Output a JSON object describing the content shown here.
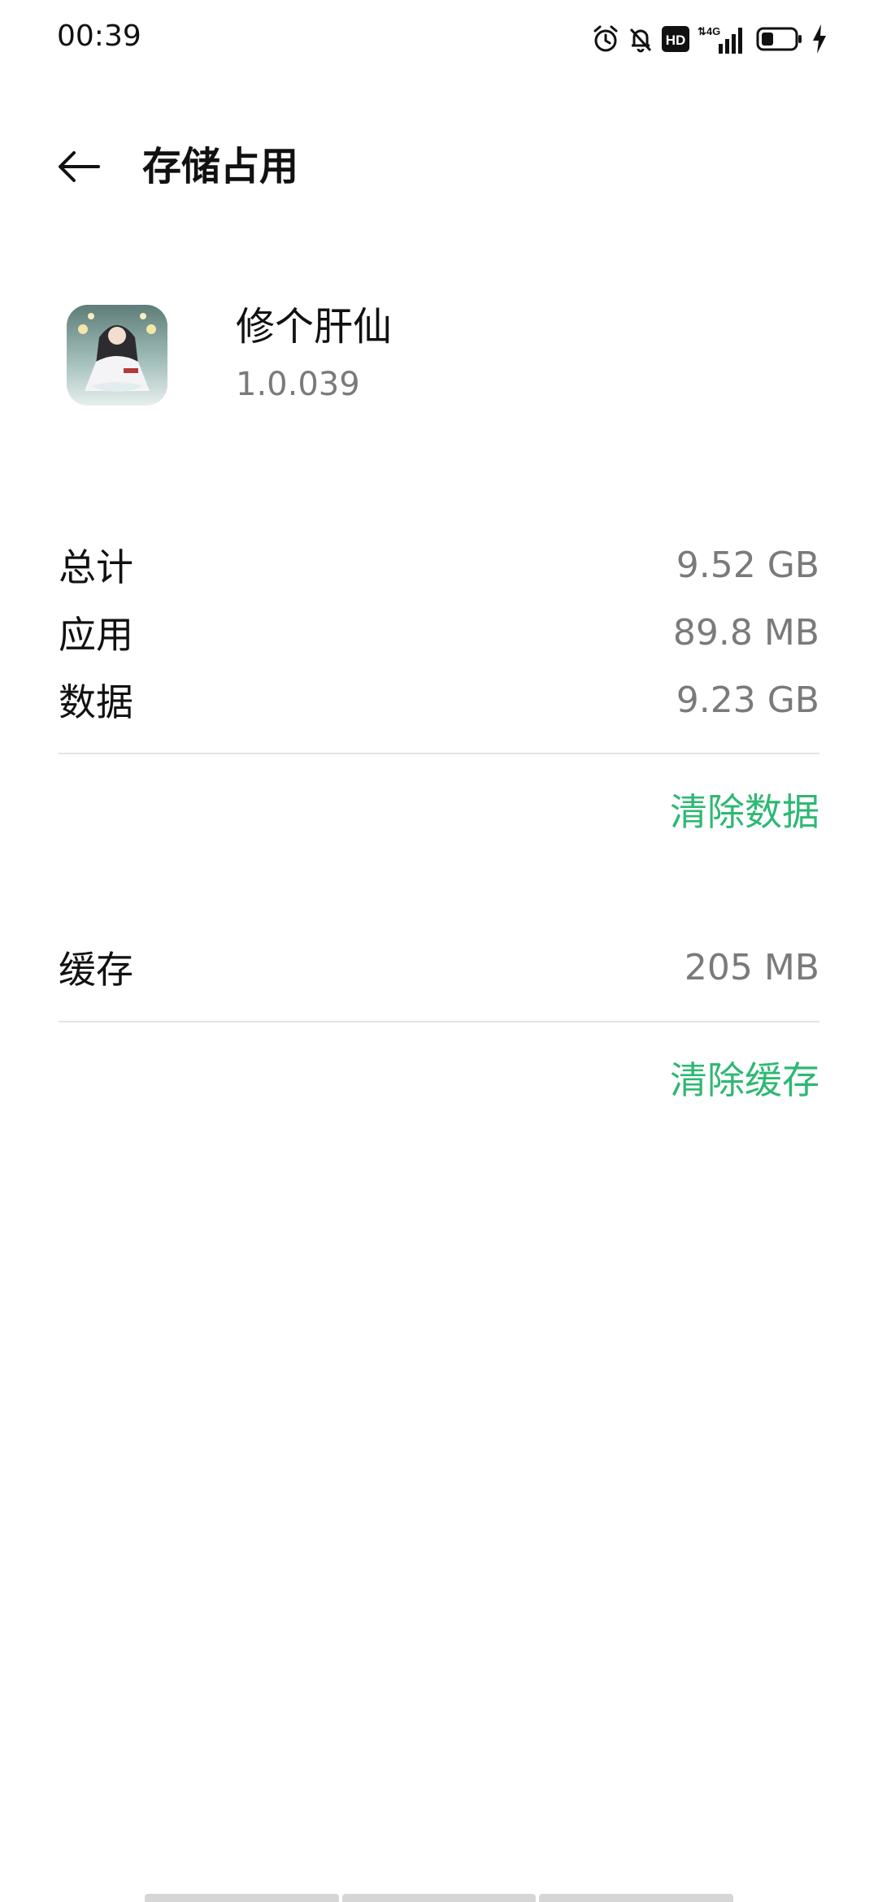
{
  "status_bar": {
    "time": "00:39",
    "icons": [
      "alarm-icon",
      "bell-off-icon",
      "hd-icon",
      "signal-4g-icon",
      "battery-icon",
      "charging-icon"
    ],
    "hd_label": "HD",
    "network_label": "4G"
  },
  "header": {
    "title": "存储占用",
    "back_icon": "arrow-left-icon"
  },
  "app": {
    "name": "修个肝仙",
    "version": "1.0.039"
  },
  "storage": {
    "rows": [
      {
        "label": "总计",
        "value": "9.52 GB"
      },
      {
        "label": "应用",
        "value": "89.8 MB"
      },
      {
        "label": "数据",
        "value": "9.23 GB"
      }
    ],
    "clear_data_label": "清除数据"
  },
  "cache": {
    "label": "缓存",
    "value": "205 MB",
    "clear_cache_label": "清除缓存"
  },
  "colors": {
    "accent": "#2fb873",
    "secondary_text": "#7a7a7a",
    "divider": "#e4e4e4"
  }
}
